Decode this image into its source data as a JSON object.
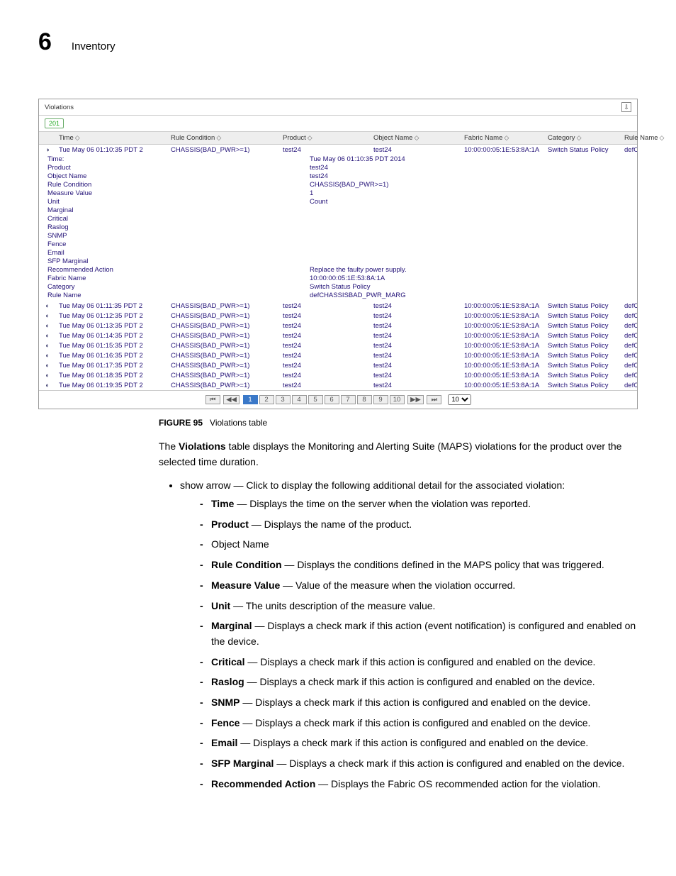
{
  "header": {
    "chapter_number": "6",
    "chapter_title": "Inventory"
  },
  "screenshot": {
    "panel_title": "Violations",
    "filter_badge": "201",
    "columns": [
      "Time",
      "Rule Condition",
      "Product",
      "Object Name",
      "Fabric Name",
      "Category",
      "Rule Name"
    ],
    "rows": [
      {
        "time": "Tue May 06 01:10:35 PDT 2",
        "rule": "CHASSIS(BAD_PWR>=1)",
        "product": "test24",
        "object": "test24",
        "fabric": "10:00:00:05:1E:53:8A:1A",
        "category": "Switch Status Policy",
        "rulename": "defCHASSISBAD_PWR_M"
      },
      {
        "time": "Tue May 06 01:11:35 PDT 2",
        "rule": "CHASSIS(BAD_PWR>=1)",
        "product": "test24",
        "object": "test24",
        "fabric": "10:00:00:05:1E:53:8A:1A",
        "category": "Switch Status Policy",
        "rulename": "defCHASSISBAD_PWR_M"
      },
      {
        "time": "Tue May 06 01:12:35 PDT 2",
        "rule": "CHASSIS(BAD_PWR>=1)",
        "product": "test24",
        "object": "test24",
        "fabric": "10:00:00:05:1E:53:8A:1A",
        "category": "Switch Status Policy",
        "rulename": "defCHASSISBAD_PWR_M"
      },
      {
        "time": "Tue May 06 01:13:35 PDT 2",
        "rule": "CHASSIS(BAD_PWR>=1)",
        "product": "test24",
        "object": "test24",
        "fabric": "10:00:00:05:1E:53:8A:1A",
        "category": "Switch Status Policy",
        "rulename": "defCHASSISBAD_PWR_M"
      },
      {
        "time": "Tue May 06 01:14:35 PDT 2",
        "rule": "CHASSIS(BAD_PWR>=1)",
        "product": "test24",
        "object": "test24",
        "fabric": "10:00:00:05:1E:53:8A:1A",
        "category": "Switch Status Policy",
        "rulename": "defCHASSISBAD_PWR_M"
      },
      {
        "time": "Tue May 06 01:15:35 PDT 2",
        "rule": "CHASSIS(BAD_PWR>=1)",
        "product": "test24",
        "object": "test24",
        "fabric": "10:00:00:05:1E:53:8A:1A",
        "category": "Switch Status Policy",
        "rulename": "defCHASSISBAD_PWR_M"
      },
      {
        "time": "Tue May 06 01:16:35 PDT 2",
        "rule": "CHASSIS(BAD_PWR>=1)",
        "product": "test24",
        "object": "test24",
        "fabric": "10:00:00:05:1E:53:8A:1A",
        "category": "Switch Status Policy",
        "rulename": "defCHASSISBAD_PWR_M"
      },
      {
        "time": "Tue May 06 01:17:35 PDT 2",
        "rule": "CHASSIS(BAD_PWR>=1)",
        "product": "test24",
        "object": "test24",
        "fabric": "10:00:00:05:1E:53:8A:1A",
        "category": "Switch Status Policy",
        "rulename": "defCHASSISBAD_PWR_M"
      },
      {
        "time": "Tue May 06 01:18:35 PDT 2",
        "rule": "CHASSIS(BAD_PWR>=1)",
        "product": "test24",
        "object": "test24",
        "fabric": "10:00:00:05:1E:53:8A:1A",
        "category": "Switch Status Policy",
        "rulename": "defCHASSISBAD_PWR_M"
      },
      {
        "time": "Tue May 06 01:19:35 PDT 2",
        "rule": "CHASSIS(BAD_PWR>=1)",
        "product": "test24",
        "object": "test24",
        "fabric": "10:00:00:05:1E:53:8A:1A",
        "category": "Switch Status Policy",
        "rulename": "defCHASSISBAD_PWR_M"
      }
    ],
    "expanded_row_index": 0,
    "detail": [
      {
        "k": "Time:",
        "v": "Tue May 06 01:10:35 PDT 2014"
      },
      {
        "k": "Product",
        "v": "test24"
      },
      {
        "k": "Object Name",
        "v": "test24"
      },
      {
        "k": "Rule Condition",
        "v": "CHASSIS(BAD_PWR>=1)"
      },
      {
        "k": "Measure Value",
        "v": "1"
      },
      {
        "k": "Unit",
        "v": "Count"
      },
      {
        "k": "Marginal",
        "v": ""
      },
      {
        "k": "Critical",
        "v": ""
      },
      {
        "k": "Raslog",
        "v": ""
      },
      {
        "k": "SNMP",
        "v": ""
      },
      {
        "k": "Fence",
        "v": ""
      },
      {
        "k": "Email",
        "v": ""
      },
      {
        "k": "SFP Marginal",
        "v": ""
      },
      {
        "k": "Recommended Action",
        "v": "Replace the faulty power supply."
      },
      {
        "k": "Fabric Name",
        "v": "10:00:00:05:1E:53:8A:1A"
      },
      {
        "k": "Category",
        "v": "Switch Status Policy"
      },
      {
        "k": "Rule Name",
        "v": "defCHASSISBAD_PWR_MARG"
      }
    ],
    "pager": {
      "pages": [
        "1",
        "2",
        "3",
        "4",
        "5",
        "6",
        "7",
        "8",
        "9",
        "10"
      ],
      "active": "1",
      "page_size": "10"
    }
  },
  "figure": {
    "label": "FIGURE 95",
    "caption": "Violations table"
  },
  "body": {
    "intro_pre": "The ",
    "intro_bold": "Violations",
    "intro_post": " table displays the Monitoring and Alerting Suite (MAPS) violations for the product over the selected time duration.",
    "bullet_show_arrow": "show arrow — Click to display the following additional detail for the associated violation:",
    "defs": [
      {
        "term": "Time",
        "text": " — Displays the time on the server when the violation was reported."
      },
      {
        "term": "Product",
        "text": " — Displays the name of the product."
      },
      {
        "term": "",
        "text": "Object Name"
      },
      {
        "term": "Rule Condition",
        "text": " — Displays the conditions defined in the MAPS policy that was triggered."
      },
      {
        "term": "Measure Value",
        "text": " — Value of the measure when the violation occurred."
      },
      {
        "term": "Unit",
        "text": " — The units description of the measure value."
      },
      {
        "term": "Marginal",
        "text": " — Displays a check mark if this action (event notification) is configured and enabled on the device."
      },
      {
        "term": "Critical",
        "text": " — Displays a check mark if this action is configured and enabled on the device."
      },
      {
        "term": "Raslog",
        "text": " — Displays a check mark if this action is configured and enabled on the device."
      },
      {
        "term": "SNMP",
        "text": " — Displays a check mark if this action is configured and enabled on the device."
      },
      {
        "term": "Fence",
        "text": " — Displays a check mark if this action is configured and enabled on the device."
      },
      {
        "term": "Email",
        "text": " — Displays a check mark if this action is configured and enabled on the device."
      },
      {
        "term": "SFP Marginal",
        "text": " — Displays a check mark if this action is configured and enabled on the device."
      },
      {
        "term": "Recommended Action",
        "text": " — Displays the Fabric OS recommended action for the violation."
      }
    ]
  }
}
